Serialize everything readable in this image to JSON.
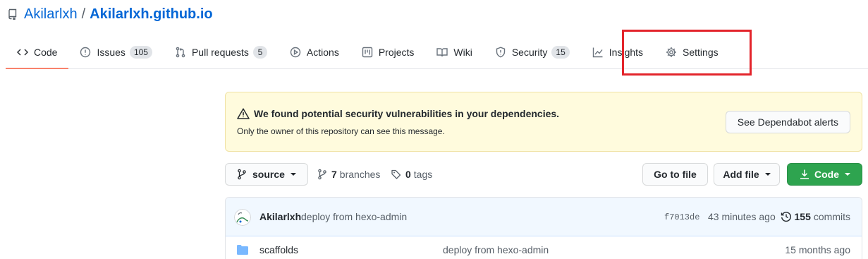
{
  "repo": {
    "owner": "Akilarlxh",
    "separator": "/",
    "name": "Akilarlxh.github.io"
  },
  "tabs": [
    {
      "label": "Code",
      "icon": "code-icon",
      "active": true
    },
    {
      "label": "Issues",
      "icon": "issue-icon",
      "count": "105"
    },
    {
      "label": "Pull requests",
      "icon": "pull-request-icon",
      "count": "5"
    },
    {
      "label": "Actions",
      "icon": "play-icon"
    },
    {
      "label": "Projects",
      "icon": "project-icon"
    },
    {
      "label": "Wiki",
      "icon": "book-icon"
    },
    {
      "label": "Security",
      "icon": "shield-icon",
      "count": "15"
    },
    {
      "label": "Insights",
      "icon": "graph-icon"
    },
    {
      "label": "Settings",
      "icon": "gear-icon"
    }
  ],
  "highlight_color": "#e3242b",
  "alert": {
    "title": "We found potential security vulnerabilities in your dependencies.",
    "subtitle": "Only the owner of this repository can see this message.",
    "button": "See Dependabot alerts"
  },
  "branch_bar": {
    "branch": "source",
    "branches_count": "7",
    "branches_label": "branches",
    "tags_count": "0",
    "tags_label": "tags",
    "goto_file": "Go to file",
    "add_file": "Add file",
    "code": "Code"
  },
  "latest_commit": {
    "author": "Akilarlxh",
    "message": "deploy from hexo-admin",
    "sha": "f7013de",
    "time": "43 minutes ago",
    "commits_count": "155",
    "commits_label": "commits"
  },
  "files": [
    {
      "name": "scaffolds",
      "type": "folder",
      "message": "deploy from hexo-admin",
      "time": "15 months ago"
    }
  ],
  "colors": {
    "link": "#0366d6",
    "active_tab_underline": "#f9826c",
    "alert_bg": "#fffbdd",
    "code_button": "#2ea44f"
  }
}
